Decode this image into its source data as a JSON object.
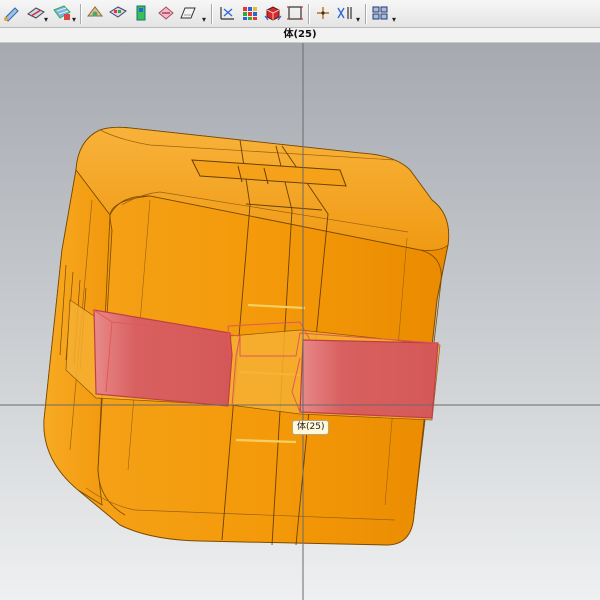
{
  "toolbar": {
    "buttons": [
      {
        "icon": "feature-edit-icon"
      },
      {
        "icon": "sketch-icon"
      },
      {
        "icon": "surface-icon"
      },
      {
        "icon": "face-blend-icon"
      },
      {
        "icon": "color-palette-icon"
      },
      {
        "icon": "layer-icon"
      },
      {
        "icon": "section-view-icon"
      },
      {
        "icon": "sheet-icon"
      },
      {
        "icon": "coordinate-system-icon"
      },
      {
        "icon": "color-grid-icon"
      },
      {
        "icon": "solid-cube-icon"
      },
      {
        "icon": "bounding-box-icon"
      },
      {
        "icon": "point-icon"
      },
      {
        "icon": "mirror-icon"
      },
      {
        "icon": "view-layout-icon"
      }
    ],
    "dropdown_glyph": "▾"
  },
  "window": {
    "title": "体(25)"
  },
  "viewport": {
    "object_color": "#f59a0a",
    "selection_color": "#d96060",
    "tooltip": "体(25)"
  }
}
